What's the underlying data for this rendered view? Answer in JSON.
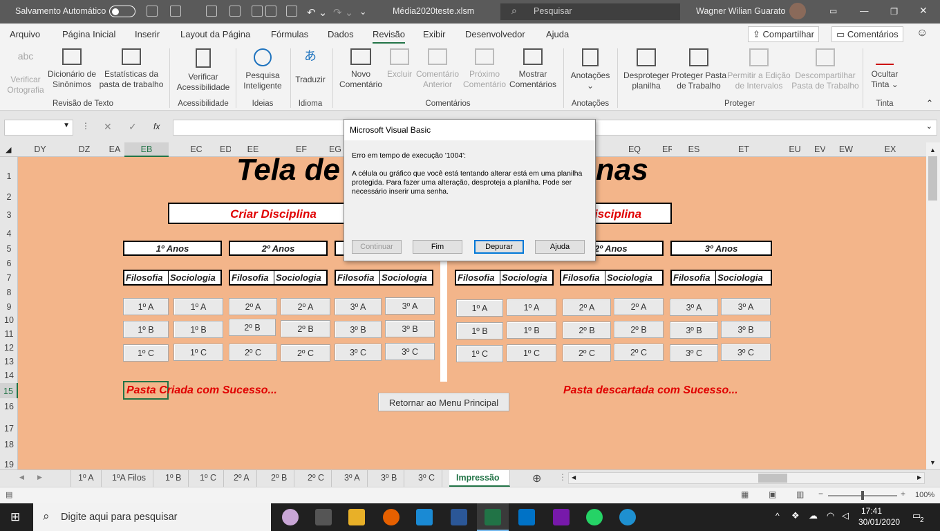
{
  "titlebar": {
    "autosave_label": "Salvamento Automático",
    "file_name": "Média2020teste.xlsm",
    "search_placeholder": "Pesquisar",
    "user": "Wagner Wilian Guarato"
  },
  "menu": {
    "tabs": [
      "Arquivo",
      "Página Inicial",
      "Inserir",
      "Layout da Página",
      "Fórmulas",
      "Dados",
      "Revisão",
      "Exibir",
      "Desenvolvedor",
      "Ajuda"
    ],
    "active": "Revisão",
    "share": "Compartilhar",
    "comments": "Comentários"
  },
  "ribbon": {
    "buttons": [
      {
        "l1": "Verificar",
        "l2": "Ortografia",
        "dis": true
      },
      {
        "l1": "Dicionário de",
        "l2": "Sinônimos"
      },
      {
        "l1": "Estatísticas da",
        "l2": "pasta de trabalho"
      },
      {
        "l1": "Verificar",
        "l2": "Acessibilidade"
      },
      {
        "l1": "Pesquisa",
        "l2": "Inteligente"
      },
      {
        "l1": "Traduzir",
        "l2": ""
      },
      {
        "l1": "Novo",
        "l2": "Comentário"
      },
      {
        "l1": "Excluir",
        "l2": "",
        "dis": true
      },
      {
        "l1": "Comentário",
        "l2": "Anterior",
        "dis": true
      },
      {
        "l1": "Próximo",
        "l2": "Comentário",
        "dis": true
      },
      {
        "l1": "Mostrar",
        "l2": "Comentários"
      },
      {
        "l1": "Anotações",
        "l2": "⌄"
      },
      {
        "l1": "Desproteger",
        "l2": "planilha"
      },
      {
        "l1": "Proteger Pasta",
        "l2": "de Trabalho"
      },
      {
        "l1": "Permitir a Edição",
        "l2": "de Intervalos",
        "dis": true
      },
      {
        "l1": "Descompartilhar",
        "l2": "Pasta de Trabalho",
        "dis": true
      },
      {
        "l1": "Ocultar",
        "l2": "Tinta ⌄"
      }
    ],
    "groups": [
      "Revisão de Texto",
      "Acessibilidade",
      "Ideias",
      "Idioma",
      "Comentários",
      "Anotações",
      "Proteger",
      "Tinta"
    ]
  },
  "formula": {
    "fx": "fx"
  },
  "columns": [
    "DY",
    "DZ",
    "EA",
    "EB",
    "EC",
    "ED",
    "EE",
    "EF",
    "EG",
    "EQ",
    "ER",
    "ES",
    "ET",
    "EU",
    "EV",
    "EW",
    "EX"
  ],
  "selected_column": "EB",
  "rows": [
    "1",
    "2",
    "3",
    "4",
    "5",
    "6",
    "7",
    "8",
    "9",
    "10",
    "11",
    "12",
    "13",
    "14",
    "15",
    "16",
    "17",
    "18",
    "19"
  ],
  "selected_row": "15",
  "sheet": {
    "title_left": "Tela de",
    "title_right": "nas",
    "create_label": "Criar Disciplina",
    "discard_label": "isciplina",
    "years": [
      "1º Anos",
      "2º Anos",
      "",
      "2º Anos",
      "3º Anos"
    ],
    "subjects": [
      "Filosofia",
      "Sociologia"
    ],
    "left_buttons": [
      [
        "1º A",
        "1º A",
        "2º A",
        "2º A",
        "3º A",
        "3º A"
      ],
      [
        "1º B",
        "1º B",
        "2º B",
        "2º B",
        "3º B",
        "3º B"
      ],
      [
        "1º C",
        "1º C",
        "2º C",
        "2º C",
        "3º C",
        "3º C"
      ]
    ],
    "right_buttons": [
      [
        "1º A",
        "1º A",
        "2º A",
        "2º A",
        "3º A",
        "3º A"
      ],
      [
        "1º B",
        "1º B",
        "2º B",
        "2º B",
        "3º B",
        "3º B"
      ],
      [
        "1º C",
        "1º C",
        "2º C",
        "2º C",
        "3º C",
        "3º C"
      ]
    ],
    "msg_left": "Pasta Criada com Sucesso...",
    "msg_right": "Pasta descartada com Sucesso...",
    "return_button": "Retornar ao Menu Principal"
  },
  "sheet_tabs": [
    "1º A",
    "1ºA Filos",
    "1º B",
    "1º C",
    "2º A",
    "2º B",
    "2º C",
    "3º A",
    "3º B",
    "3º C",
    "Impressão"
  ],
  "active_tab": "Impressão",
  "status": {
    "zoom": "100%"
  },
  "dialog": {
    "title": "Microsoft Visual Basic",
    "error": "Erro em tempo de execução '1004':",
    "message": "A célula ou gráfico que você está tentando alterar está em uma planilha protegida. Para fazer uma alteração, desproteja a planilha. Pode ser necessário inserir uma senha.",
    "buttons": {
      "continue": "Continuar",
      "end": "Fim",
      "debug": "Depurar",
      "help": "Ajuda"
    }
  },
  "taskbar": {
    "search_placeholder": "Digite aqui para pesquisar",
    "time": "17:41",
    "date": "30/01/2020",
    "notifications": "2"
  }
}
